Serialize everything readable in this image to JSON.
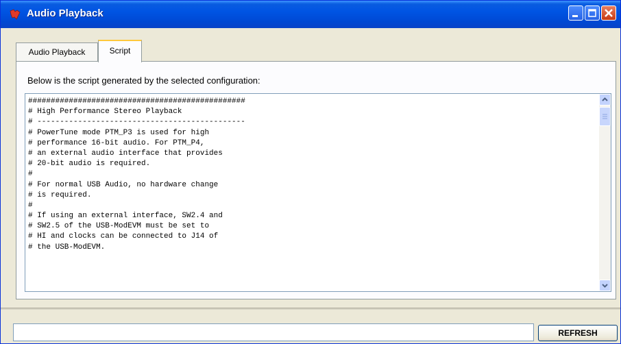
{
  "window": {
    "title": "Audio Playback",
    "colors": {
      "titlebar": "#0054e3",
      "frame": "#ece9d8",
      "close_button": "#c73a12",
      "active_tab_accent": "#ffc83c"
    }
  },
  "tabs": [
    {
      "label": "Audio Playback",
      "selected": false
    },
    {
      "label": "Script",
      "selected": true
    }
  ],
  "script_panel": {
    "description": "Below is the script generated by the selected configuration:",
    "lines": [
      "################################################",
      "# High Performance Stereo Playback",
      "# ----------------------------------------------",
      "# PowerTune mode PTM_P3 is used for high",
      "# performance 16-bit audio. For PTM_P4,",
      "# an external audio interface that provides",
      "# 20-bit audio is required.",
      "#",
      "# For normal USB Audio, no hardware change",
      "# is required.",
      "#",
      "# If using an external interface, SW2.4 and",
      "# SW2.5 of the USB-ModEVM must be set to",
      "# HI and clocks can be connected to J14 of",
      "# the USB-ModEVM."
    ]
  },
  "footer": {
    "status_value": "",
    "refresh_label": "REFRESH"
  },
  "icons": {
    "app": "ti-logo-icon",
    "minimize": "minimize-icon",
    "maximize": "maximize-icon",
    "close": "close-icon",
    "scroll_up": "scroll-up-arrow-icon",
    "scroll_down": "scroll-down-arrow-icon"
  }
}
